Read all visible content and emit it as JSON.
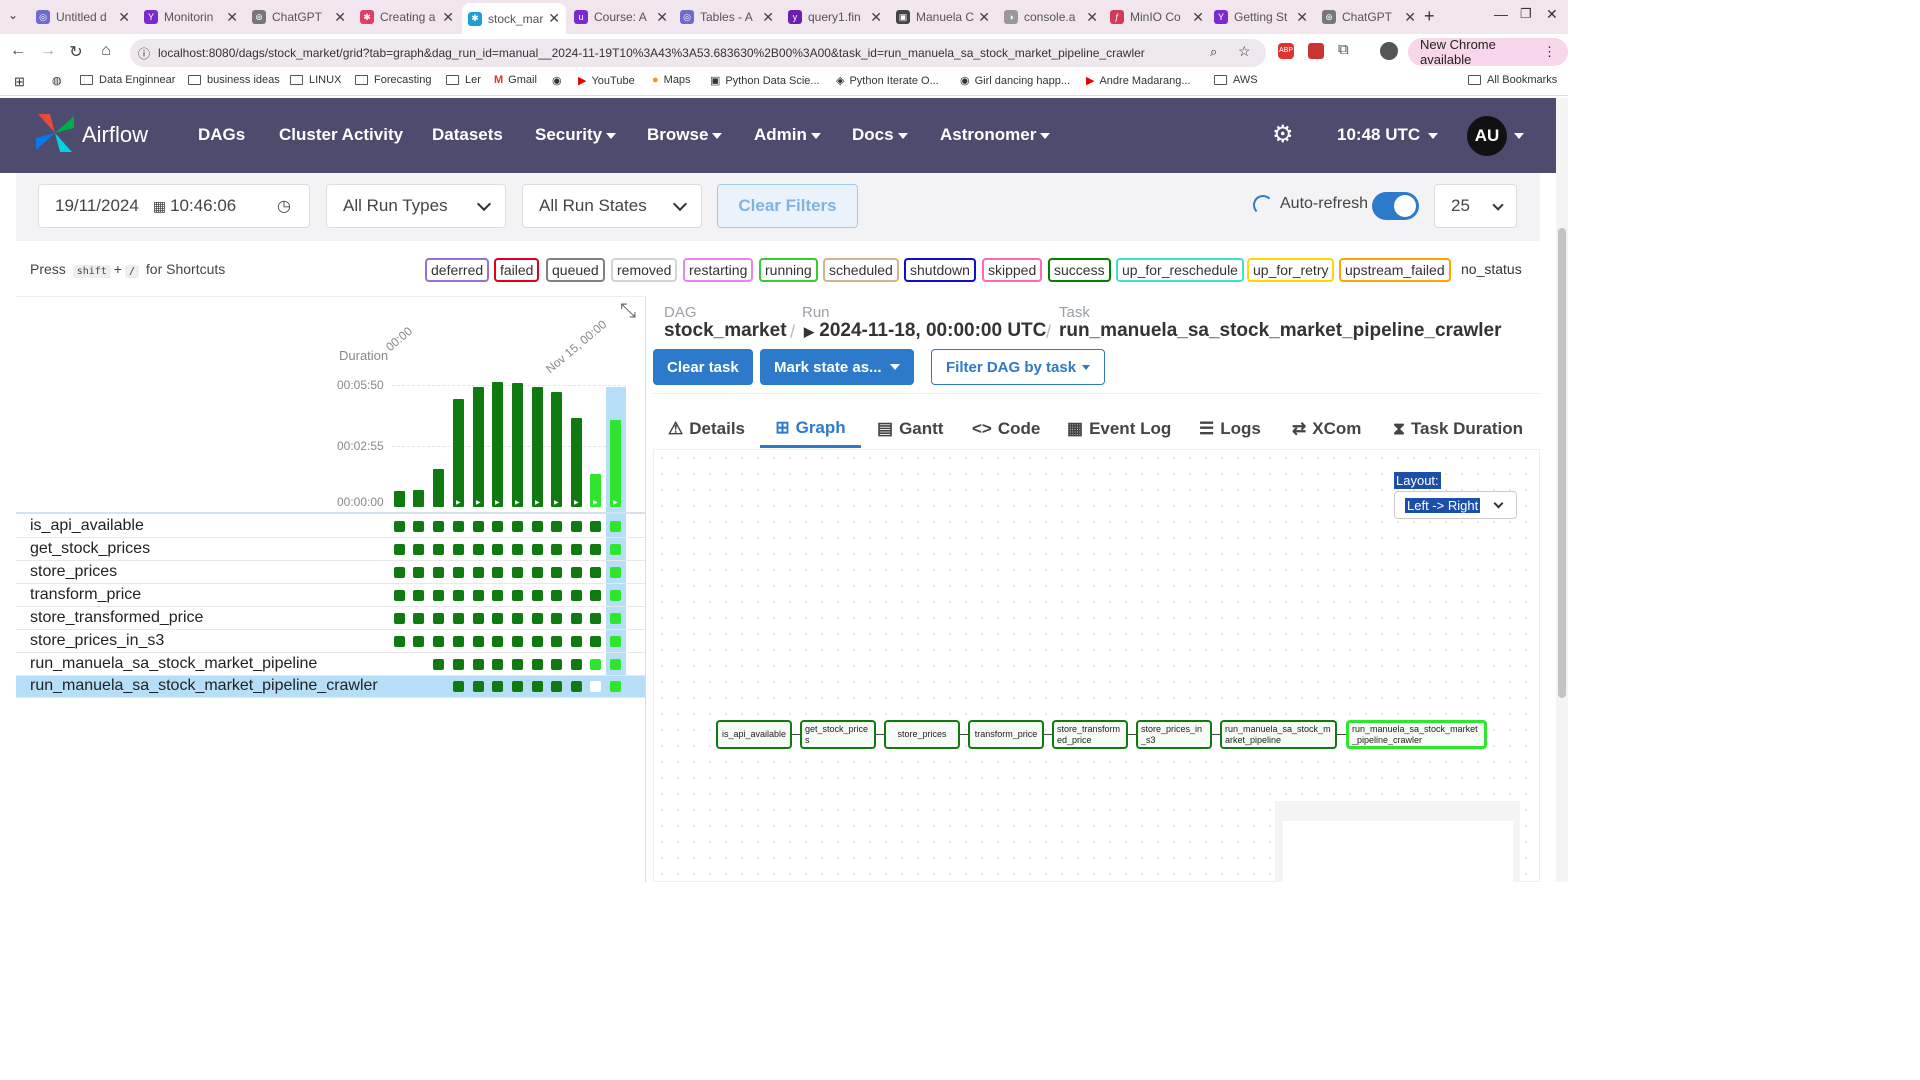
{
  "browser": {
    "tabs": [
      "Untitled d",
      "Monitorin",
      "ChatGPT",
      "Creating a",
      "stock_mar",
      "Course: A",
      "Tables - A",
      "query1.fin",
      "Manuela C",
      "console.a",
      "MinIO Co",
      "Getting St",
      "ChatGPT"
    ],
    "url": "localhost:8080/dags/stock_market/grid?tab=graph&dag_run_id=manual__2024-11-19T10%3A43%3A53.683630%2B00%3A00&task_id=run_manuela_sa_stock_market_pipeline_crawler",
    "new_chrome": "New Chrome available",
    "bookmarks": [
      "Data Enginnear",
      "business ideas",
      "LINUX",
      "Forecasting",
      "Ler",
      "Gmail",
      "YouTube",
      "Maps",
      "Python Data Scie...",
      "Python Iterate O...",
      "Girl dancing happ...",
      "Andre Madarang...",
      "AWS"
    ],
    "all_bookmarks": "All Bookmarks"
  },
  "nav": {
    "brand": "Airflow",
    "items": [
      "DAGs",
      "Cluster Activity",
      "Datasets",
      "Security",
      "Browse",
      "Admin",
      "Docs",
      "Astronomer"
    ],
    "time": "10:48 UTC",
    "user": "AU"
  },
  "filters": {
    "date": "19/11/2024",
    "time": "10:46:06",
    "run_types": "All Run Types",
    "run_states": "All Run States",
    "clear": "Clear Filters",
    "autorefresh": "Auto-refresh",
    "page_size": "25"
  },
  "shortcuts": {
    "press": "Press",
    "key1": "shift",
    "plus": "+",
    "key2": "/",
    "suffix": "for Shortcuts"
  },
  "legend": [
    {
      "label": "deferred",
      "color": "#9370db"
    },
    {
      "label": "failed",
      "color": "#e0001a"
    },
    {
      "label": "queued",
      "color": "#808080"
    },
    {
      "label": "removed",
      "color": "#d3d3d3"
    },
    {
      "label": "restarting",
      "color": "#ee82ee"
    },
    {
      "label": "running",
      "color": "#32cd32"
    },
    {
      "label": "scheduled",
      "color": "#d2b48c"
    },
    {
      "label": "shutdown",
      "color": "#1010c8"
    },
    {
      "label": "skipped",
      "color": "#ff69b4"
    },
    {
      "label": "success",
      "color": "#008000"
    },
    {
      "label": "up_for_reschedule",
      "color": "#40e0d0"
    },
    {
      "label": "up_for_retry",
      "color": "#ffd700"
    },
    {
      "label": "upstream_failed",
      "color": "#ffa500"
    }
  ],
  "no_status": "no_status",
  "grid": {
    "duration_label": "Duration",
    "date_labels": [
      "00:00",
      "Nov 15, 00:00"
    ],
    "y_ticks": [
      "00:05:50",
      "00:02:55",
      "00:00:00"
    ],
    "run_durations_sec": [
      45,
      50,
      110,
      310,
      345,
      360,
      355,
      345,
      330,
      255,
      95,
      250
    ],
    "tasks": [
      "is_api_available",
      "get_stock_prices",
      "store_prices",
      "transform_price",
      "store_transformed_price",
      "store_prices_in_s3",
      "run_manuela_sa_stock_market_pipeline",
      "run_manuela_sa_stock_market_pipeline_crawler"
    ]
  },
  "details": {
    "dag_label": "DAG",
    "dag": "stock_market",
    "run_label": "Run",
    "run": "2024-11-18, 00:00:00 UTC",
    "task_label": "Task",
    "task": "run_manuela_sa_stock_market_pipeline_crawler",
    "buttons": [
      "Clear task",
      "Mark state as...",
      "Filter DAG by task"
    ],
    "tabs": [
      "Details",
      "Graph",
      "Gantt",
      "Code",
      "Event Log",
      "Logs",
      "XCom",
      "Task Duration"
    ],
    "layout_label": "Layout:",
    "layout_value": "Left -> Right"
  },
  "graph_nodes": [
    "is_api_available",
    "get_stock_prices",
    "store_prices",
    "transform_price",
    "store_transformed_price",
    "store_prices_in_s3",
    "run_manuela_sa_stock_market_pipeline",
    "run_manuela_sa_stock_market_pipeline_crawler"
  ],
  "colors": {
    "success": "#0f7a0f",
    "running": "#2ee62e",
    "nav": "#4e4b6e",
    "primary": "#2c7ac9"
  }
}
